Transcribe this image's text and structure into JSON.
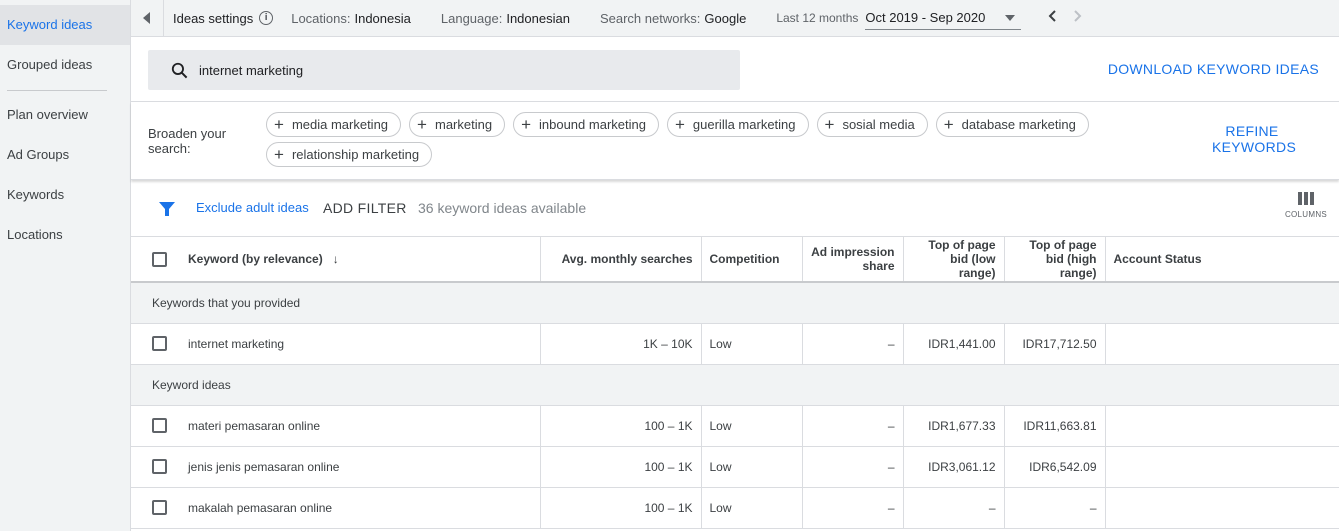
{
  "sidebar": {
    "items": [
      {
        "label": "Keyword ideas",
        "active": true
      },
      {
        "label": "Grouped ideas",
        "active": false
      },
      {
        "label": "Plan overview",
        "active": false
      },
      {
        "label": "Ad Groups",
        "active": false
      },
      {
        "label": "Keywords",
        "active": false
      },
      {
        "label": "Locations",
        "active": false
      }
    ]
  },
  "topbar": {
    "ideas_settings": "Ideas settings",
    "locations_label": "Locations:",
    "locations_value": "Indonesia",
    "language_label": "Language:",
    "language_value": "Indonesian",
    "networks_label": "Search networks:",
    "networks_value": "Google",
    "period_label": "Last 12 months",
    "period_value": "Oct 2019 - Sep 2020"
  },
  "search": {
    "value": "internet marketing"
  },
  "download_label": "DOWNLOAD KEYWORD IDEAS",
  "broaden": {
    "label": "Broaden your search:",
    "chips": [
      "media marketing",
      "marketing",
      "inbound marketing",
      "guerilla marketing",
      "sosial media",
      "database marketing",
      "relationship marketing"
    ]
  },
  "refine_label": "REFINE KEYWORDS",
  "filters": {
    "exclude_adult": "Exclude adult ideas",
    "add_filter": "ADD FILTER",
    "available": "36 keyword ideas available",
    "columns": "COLUMNS"
  },
  "table": {
    "headers": {
      "keyword": "Keyword (by relevance)",
      "avg": "Avg. monthly searches",
      "competition": "Competition",
      "impression": "Ad impression share",
      "low": "Top of page bid (low range)",
      "high": "Top of page bid (high range)",
      "status": "Account Status"
    },
    "provided_label": "Keywords that you provided",
    "provided_rows": [
      {
        "keyword": "internet marketing",
        "avg": "1K – 10K",
        "competition": "Low",
        "impression": "–",
        "low": "IDR1,441.00",
        "high": "IDR17,712.50",
        "status": ""
      }
    ],
    "ideas_label": "Keyword ideas",
    "idea_rows": [
      {
        "keyword": "materi pemasaran online",
        "avg": "100 – 1K",
        "competition": "Low",
        "impression": "–",
        "low": "IDR1,677.33",
        "high": "IDR11,663.81",
        "status": ""
      },
      {
        "keyword": "jenis jenis pemasaran online",
        "avg": "100 – 1K",
        "competition": "Low",
        "impression": "–",
        "low": "IDR3,061.12",
        "high": "IDR6,542.09",
        "status": ""
      },
      {
        "keyword": "makalah pemasaran online",
        "avg": "100 – 1K",
        "competition": "Low",
        "impression": "–",
        "low": "–",
        "high": "–",
        "status": ""
      }
    ]
  }
}
